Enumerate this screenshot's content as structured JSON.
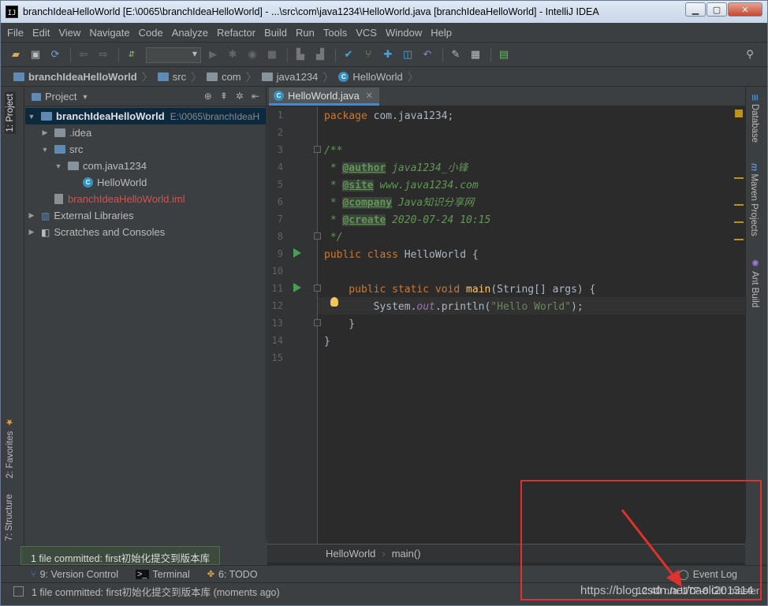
{
  "window": {
    "title": "branchIdeaHelloWorld [E:\\0065\\branchIdeaHelloWorld] - ...\\src\\com\\java1234\\HelloWorld.java [branchIdeaHelloWorld] - IntelliJ IDEA",
    "app_icon": "IJ"
  },
  "menu": [
    "File",
    "Edit",
    "View",
    "Navigate",
    "Code",
    "Analyze",
    "Refactor",
    "Build",
    "Run",
    "Tools",
    "VCS",
    "Window",
    "Help"
  ],
  "breadcrumbs": [
    "branchIdeaHelloWorld",
    "src",
    "com",
    "java1234",
    "HelloWorld"
  ],
  "left_tabs": {
    "project": "1: Project",
    "favorites": "2: Favorites",
    "structure": "7: Structure"
  },
  "right_tabs": {
    "database": "Database",
    "maven": "Maven Projects",
    "ant": "Ant Build"
  },
  "project": {
    "header": "Project",
    "tree": [
      {
        "label": "branchIdeaHelloWorld",
        "suffix": "E:\\0065\\branchIdeaH",
        "level": 0,
        "arrow": "▼",
        "icon": "folder"
      },
      {
        "label": ".idea",
        "level": 1,
        "arrow": "▶",
        "icon": "folder"
      },
      {
        "label": "src",
        "level": 1,
        "arrow": "▼",
        "icon": "folder"
      },
      {
        "label": "com.java1234",
        "level": 2,
        "arrow": "▼",
        "icon": "package"
      },
      {
        "label": "HelloWorld",
        "level": 3,
        "arrow": "",
        "icon": "class"
      },
      {
        "label": "branchIdeaHelloWorld.iml",
        "level": 1,
        "arrow": "",
        "icon": "iml"
      },
      {
        "label": "External Libraries",
        "level": 0,
        "arrow": "▶",
        "icon": "library"
      },
      {
        "label": "Scratches and Consoles",
        "level": 0,
        "arrow": "▶",
        "icon": "scratch"
      }
    ]
  },
  "editor": {
    "tab": "HelloWorld.java",
    "line_numbers": [
      "1",
      "2",
      "3",
      "4",
      "5",
      "6",
      "7",
      "8",
      "9",
      "10",
      "11",
      "12",
      "13",
      "14",
      "15"
    ],
    "code": {
      "l1_kw": "package",
      "l1_rest": " com.java1234;",
      "l3": "/**",
      "l4_star": " * ",
      "l4_tag": "@author",
      "l4_val": " java1234_小锋",
      "l5_tag": "@site",
      "l5_val": " www.java1234.com",
      "l6_tag": "@company",
      "l6_val": " Java知识分享网",
      "l7_tag": "@create",
      "l7_val": " 2020-07-24 10:15",
      "l8": " */",
      "l9_kw": "public class",
      "l9_rest": " HelloWorld {",
      "l11_kw": "    public static void",
      "l11_fn": " main",
      "l11_rest": "(String[] args) {",
      "l12_a": "        System.",
      "l12_out": "out",
      "l12_b": ".println(",
      "l12_str": "\"Hello World\"",
      "l12_c": ");",
      "l13": "    }",
      "l14": "}"
    },
    "crumb": [
      "HelloWorld",
      "main()"
    ]
  },
  "bottom_tabs": {
    "vcs": "9: Version Control",
    "terminal": "Terminal",
    "todo": "6: TODO",
    "event_log": "Event Log"
  },
  "status": {
    "message": "1 file committed: first初始化提交到版本库 (moments ago)",
    "popup": "1 file committed: first初始化提交到版本库",
    "right": "12:40  n/a  UTF-8  Git: master"
  },
  "watermark": "https://blog.csdn.net/caoli201314",
  "colors": {
    "keyword": "#cc7832",
    "comment": "#629755",
    "string": "#6a8759",
    "annotation_box": "#e0322c",
    "selection": "#0d293e"
  }
}
